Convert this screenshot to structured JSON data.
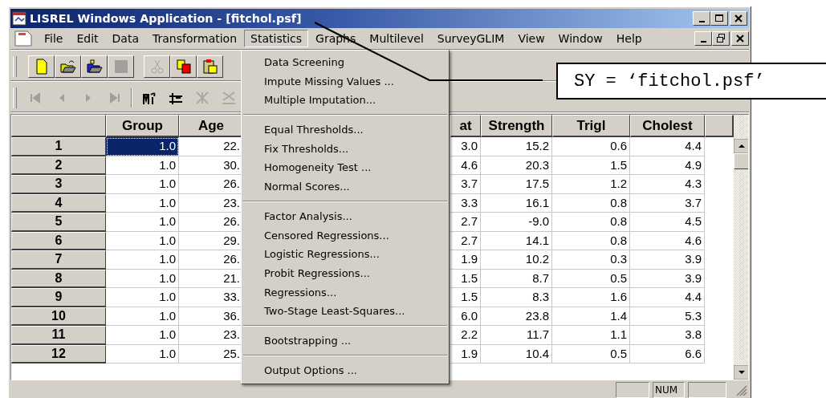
{
  "window": {
    "title": "LISREL Windows Application - [fitchol.psf]"
  },
  "menu_bar": [
    {
      "label": "File",
      "selected": false
    },
    {
      "label": "Edit",
      "selected": false
    },
    {
      "label": "Data",
      "selected": false
    },
    {
      "label": "Transformation",
      "selected": false
    },
    {
      "label": "Statistics",
      "selected": true
    },
    {
      "label": "Graphs",
      "selected": false
    },
    {
      "label": "Multilevel",
      "selected": false
    },
    {
      "label": "SurveyGLIM",
      "selected": false
    },
    {
      "label": "View",
      "selected": false
    },
    {
      "label": "Window",
      "selected": false
    },
    {
      "label": "Help",
      "selected": false
    }
  ],
  "toolbars": [
    {
      "groups": [
        [
          {
            "kind": "new",
            "disabled": false
          },
          {
            "kind": "open",
            "disabled": false
          },
          {
            "kind": "open-alt",
            "disabled": false
          },
          {
            "kind": "stop",
            "disabled": true
          }
        ],
        [
          {
            "kind": "cut",
            "disabled": true
          },
          {
            "kind": "copy",
            "disabled": false
          },
          {
            "kind": "paste",
            "disabled": false
          }
        ]
      ]
    },
    {
      "groups": [
        [
          {
            "kind": "first",
            "disabled": true
          },
          {
            "kind": "prev",
            "disabled": true
          },
          {
            "kind": "next",
            "disabled": true
          },
          {
            "kind": "last",
            "disabled": true
          }
        ],
        [
          {
            "kind": "insert-var",
            "disabled": false
          },
          {
            "kind": "insert-case",
            "disabled": false
          },
          {
            "kind": "delete-var",
            "disabled": true
          },
          {
            "kind": "delete-case",
            "disabled": true
          }
        ]
      ]
    }
  ],
  "statistics_menu": {
    "sections": [
      [
        "Data Screening",
        "Impute Missing Values ...",
        "Multiple Imputation..."
      ],
      [
        "Equal Thresholds...",
        "Fix Thresholds...",
        "Homogeneity Test ...",
        "Normal Scores..."
      ],
      [
        "Factor Analysis...",
        "Censored Regressions...",
        "Logistic Regressions...",
        "Probit Regressions...",
        "Regressions...",
        "Two-Stage Least-Squares..."
      ],
      [
        "Bootstrapping ..."
      ],
      [
        "Output Options ..."
      ]
    ]
  },
  "table": {
    "columns": [
      "Group",
      "Age",
      "at",
      "Strength",
      "Trigl",
      "Cholest"
    ],
    "rows": [
      {
        "number": "1",
        "cells": [
          {
            "text": "1.0",
            "selected": true
          },
          {
            "text": "22.",
            "selected": false
          },
          {
            "text": "3.0",
            "selected": false
          },
          {
            "text": "15.2",
            "selected": false
          },
          {
            "text": "0.6",
            "selected": false
          },
          {
            "text": "4.4",
            "selected": false
          }
        ]
      },
      {
        "number": "2",
        "cells": [
          {
            "text": "1.0",
            "selected": false
          },
          {
            "text": "30.",
            "selected": false
          },
          {
            "text": "4.6",
            "selected": false
          },
          {
            "text": "20.3",
            "selected": false
          },
          {
            "text": "1.5",
            "selected": false
          },
          {
            "text": "4.9",
            "selected": false
          }
        ]
      },
      {
        "number": "3",
        "cells": [
          {
            "text": "1.0",
            "selected": false
          },
          {
            "text": "26.",
            "selected": false
          },
          {
            "text": "3.7",
            "selected": false
          },
          {
            "text": "17.5",
            "selected": false
          },
          {
            "text": "1.2",
            "selected": false
          },
          {
            "text": "4.3",
            "selected": false
          }
        ]
      },
      {
        "number": "4",
        "cells": [
          {
            "text": "1.0",
            "selected": false
          },
          {
            "text": "23.",
            "selected": false
          },
          {
            "text": "3.3",
            "selected": false
          },
          {
            "text": "16.1",
            "selected": false
          },
          {
            "text": "0.8",
            "selected": false
          },
          {
            "text": "3.7",
            "selected": false
          }
        ]
      },
      {
        "number": "5",
        "cells": [
          {
            "text": "1.0",
            "selected": false
          },
          {
            "text": "26.",
            "selected": false
          },
          {
            "text": "2.7",
            "selected": false
          },
          {
            "text": "-9.0",
            "selected": false
          },
          {
            "text": "0.8",
            "selected": false
          },
          {
            "text": "4.5",
            "selected": false
          }
        ]
      },
      {
        "number": "6",
        "cells": [
          {
            "text": "1.0",
            "selected": false
          },
          {
            "text": "29.",
            "selected": false
          },
          {
            "text": "2.7",
            "selected": false
          },
          {
            "text": "14.1",
            "selected": false
          },
          {
            "text": "0.8",
            "selected": false
          },
          {
            "text": "4.6",
            "selected": false
          }
        ]
      },
      {
        "number": "7",
        "cells": [
          {
            "text": "1.0",
            "selected": false
          },
          {
            "text": "26.",
            "selected": false
          },
          {
            "text": "1.9",
            "selected": false
          },
          {
            "text": "10.2",
            "selected": false
          },
          {
            "text": "0.3",
            "selected": false
          },
          {
            "text": "3.9",
            "selected": false
          }
        ]
      },
      {
        "number": "8",
        "cells": [
          {
            "text": "1.0",
            "selected": false
          },
          {
            "text": "21.",
            "selected": false
          },
          {
            "text": "1.5",
            "selected": false
          },
          {
            "text": "8.7",
            "selected": false
          },
          {
            "text": "0.5",
            "selected": false
          },
          {
            "text": "3.9",
            "selected": false
          }
        ]
      },
      {
        "number": "9",
        "cells": [
          {
            "text": "1.0",
            "selected": false
          },
          {
            "text": "33.",
            "selected": false
          },
          {
            "text": "1.5",
            "selected": false
          },
          {
            "text": "8.3",
            "selected": false
          },
          {
            "text": "1.6",
            "selected": false
          },
          {
            "text": "4.4",
            "selected": false
          }
        ]
      },
      {
        "number": "10",
        "cells": [
          {
            "text": "1.0",
            "selected": false
          },
          {
            "text": "36.",
            "selected": false
          },
          {
            "text": "6.0",
            "selected": false
          },
          {
            "text": "23.8",
            "selected": false
          },
          {
            "text": "1.4",
            "selected": false
          },
          {
            "text": "5.3",
            "selected": false
          }
        ]
      },
      {
        "number": "11",
        "cells": [
          {
            "text": "1.0",
            "selected": false
          },
          {
            "text": "23.",
            "selected": false
          },
          {
            "text": "2.2",
            "selected": false
          },
          {
            "text": "11.7",
            "selected": false
          },
          {
            "text": "1.1",
            "selected": false
          },
          {
            "text": "3.8",
            "selected": false
          }
        ]
      },
      {
        "number": "12",
        "cells": [
          {
            "text": "1.0",
            "selected": false
          },
          {
            "text": "25.",
            "selected": false
          },
          {
            "text": "1.9",
            "selected": false
          },
          {
            "text": "10.4",
            "selected": false
          },
          {
            "text": "0.5",
            "selected": false
          },
          {
            "text": "6.6",
            "selected": false
          }
        ]
      }
    ]
  },
  "status_bar": {
    "indicator": "NUM"
  },
  "annotation": {
    "text": "SY = ‘fitchol.psf’"
  }
}
